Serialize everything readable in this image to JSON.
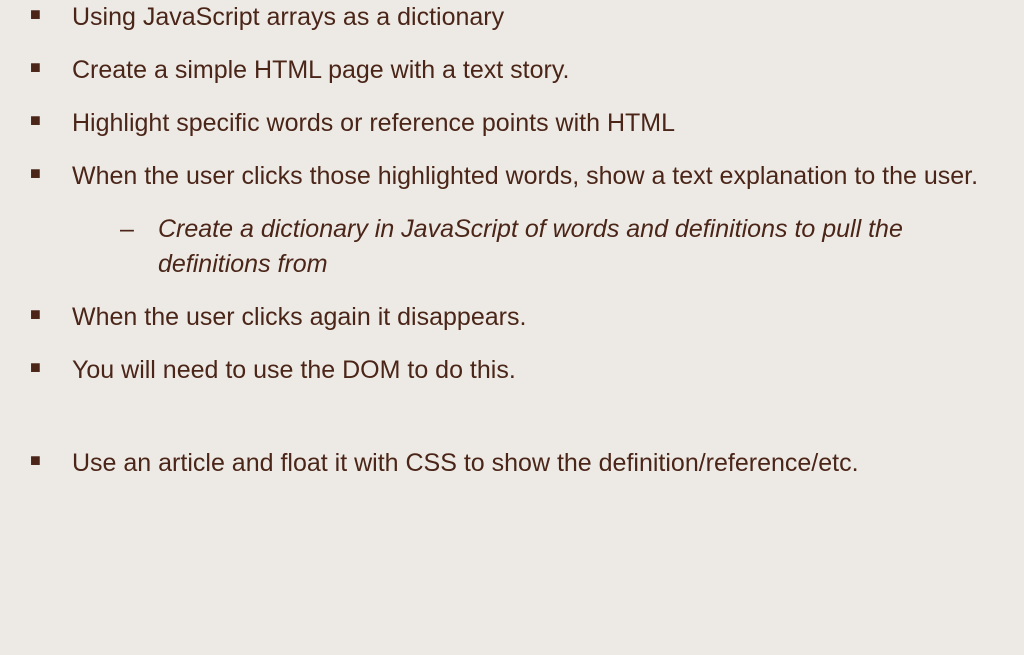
{
  "bullets": [
    {
      "text": "Using JavaScript arrays as a dictionary",
      "sub": null
    },
    {
      "text": "Create a simple HTML page with a text story.",
      "sub": null
    },
    {
      "text": "Highlight specific words or reference points with HTML",
      "sub": null
    },
    {
      "text": "When the user clicks those highlighted words, show a text explanation to the user.",
      "sub": "Create a dictionary in JavaScript of words and definitions to pull the definitions from"
    },
    {
      "text": "When the user clicks again it disappears.",
      "sub": null
    },
    {
      "text": "You will need to use the DOM to do this.",
      "sub": null
    }
  ],
  "bulletsAfterGap": [
    {
      "text": "Use an article and float it with CSS to show the definition/reference/etc.",
      "sub": null
    }
  ]
}
